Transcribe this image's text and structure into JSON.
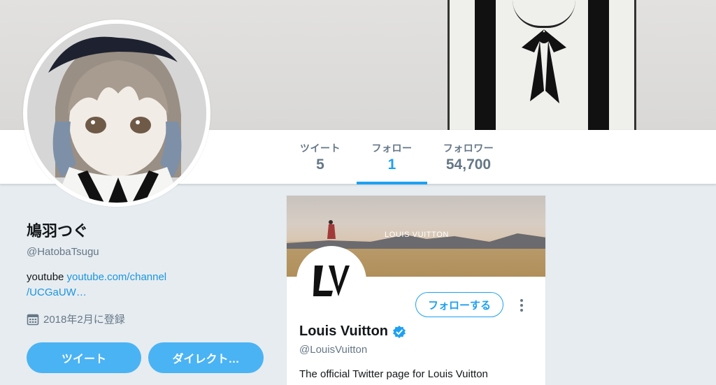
{
  "nav": {
    "tweets": {
      "label": "ツイート",
      "count": "5"
    },
    "following": {
      "label": "フォロー",
      "count": "1"
    },
    "followers": {
      "label": "フォロワー",
      "count": "54,700"
    }
  },
  "profile": {
    "name": "鳩羽つぐ",
    "screen_name": "@HatobaTsugu",
    "bio_text": "youtube ",
    "bio_link_line1": "youtube.com/channel",
    "bio_link_line2": "/UCGaUW…",
    "joined": "2018年2月に登録",
    "tweet_button": "ツイート",
    "dm_button": "ダイレクト…"
  },
  "card": {
    "banner_brand": "LOUIS VUITTON",
    "name": "Louis Vuitton",
    "screen_name": "@LouisVuitton",
    "follow_button": "フォローする",
    "bio": "The official Twitter page for Louis Vuitton"
  },
  "colors": {
    "accent": "#1da1f2",
    "button": "#4ab3f4",
    "muted": "#657786",
    "background": "#e6ecf0"
  }
}
